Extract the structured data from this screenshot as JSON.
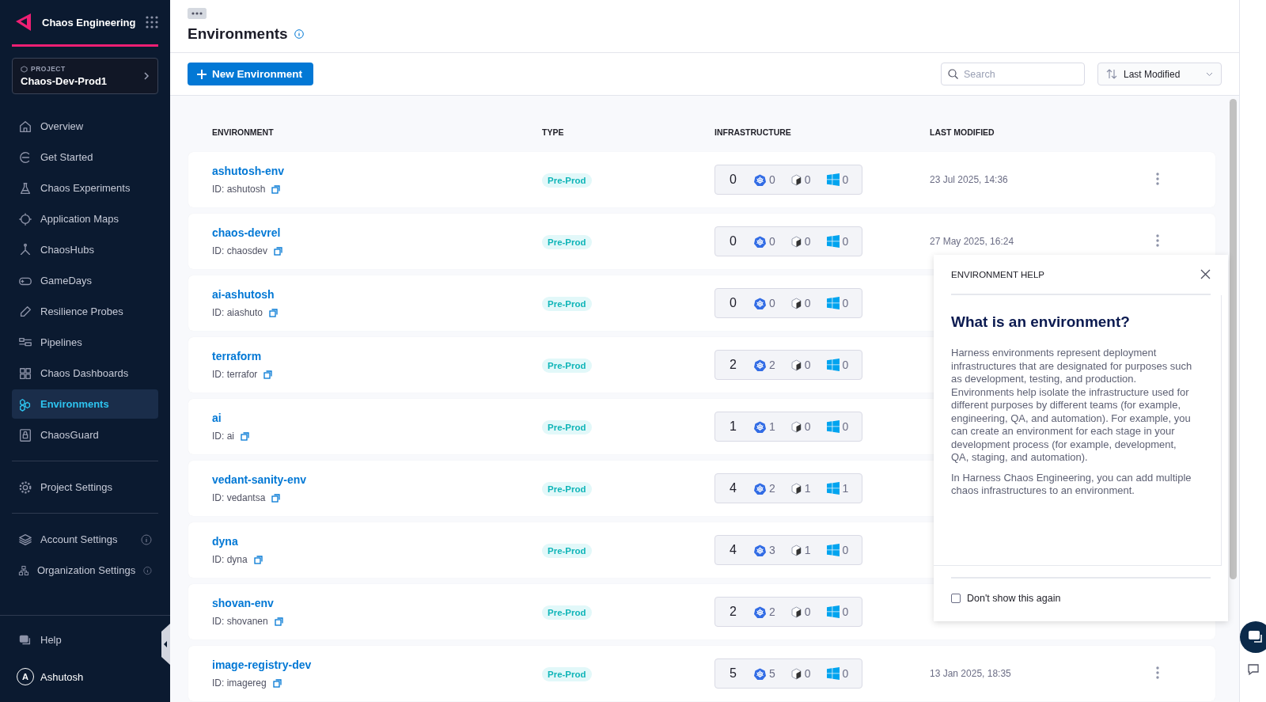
{
  "sidebar": {
    "module_title": "Chaos Engineering",
    "project": {
      "label": "PROJECT",
      "name": "Chaos-Dev-Prod1"
    },
    "nav": [
      {
        "label": "Overview",
        "selected": false
      },
      {
        "label": "Get Started",
        "selected": false
      },
      {
        "label": "Chaos Experiments",
        "selected": false
      },
      {
        "label": "Application Maps",
        "selected": false
      },
      {
        "label": "ChaosHubs",
        "selected": false
      },
      {
        "label": "GameDays",
        "selected": false
      },
      {
        "label": "Resilience Probes",
        "selected": false
      },
      {
        "label": "Pipelines",
        "selected": false
      },
      {
        "label": "Chaos Dashboards",
        "selected": false
      },
      {
        "label": "Environments",
        "selected": true
      },
      {
        "label": "ChaosGuard",
        "selected": false
      }
    ],
    "project_settings": {
      "label": "Project Settings"
    },
    "admin": [
      {
        "label": "Account Settings"
      },
      {
        "label": "Organization Settings"
      }
    ],
    "help": "Help",
    "user": {
      "initial": "A",
      "name": "Ashutosh"
    }
  },
  "header": {
    "title": "Environments"
  },
  "toolbar": {
    "new_button": "New Environment",
    "search": {
      "placeholder": "Search"
    },
    "sort": "Last Modified"
  },
  "table": {
    "columns": [
      "ENVIRONMENT",
      "TYPE",
      "INFRASTRUCTURE",
      "LAST MODIFIED"
    ],
    "rows": [
      {
        "name": "ashutosh-env",
        "id": "ID: ashutosh",
        "type": "Pre-Prod",
        "infra": {
          "total": "0",
          "kubernetes": "0",
          "linux": "0",
          "windows": "0"
        },
        "last_modified": "23 Jul 2025, 14:36"
      },
      {
        "name": "chaos-devrel",
        "id": "ID: chaosdev",
        "type": "Pre-Prod",
        "infra": {
          "total": "0",
          "kubernetes": "0",
          "linux": "0",
          "windows": "0"
        },
        "last_modified": "27 May 2025, 16:24"
      },
      {
        "name": "ai-ashutosh",
        "id": "ID: aiashuto",
        "type": "Pre-Prod",
        "infra": {
          "total": "0",
          "kubernetes": "0",
          "linux": "0",
          "windows": "0"
        }
      },
      {
        "name": "terraform",
        "id": "ID: terrafor",
        "type": "Pre-Prod",
        "infra": {
          "total": "2",
          "kubernetes": "2",
          "linux": "0",
          "windows": "0"
        }
      },
      {
        "name": "ai",
        "id": "ID: ai",
        "type": "Pre-Prod",
        "infra": {
          "total": "1",
          "kubernetes": "1",
          "linux": "0",
          "windows": "0"
        }
      },
      {
        "name": "vedant-sanity-env",
        "id": "ID: vedantsa",
        "type": "Pre-Prod",
        "infra": {
          "total": "4",
          "kubernetes": "2",
          "linux": "1",
          "windows": "1"
        }
      },
      {
        "name": "dyna",
        "id": "ID: dyna",
        "type": "Pre-Prod",
        "infra": {
          "total": "4",
          "kubernetes": "3",
          "linux": "1",
          "windows": "0"
        }
      },
      {
        "name": "shovan-env",
        "id": "ID: shovanen",
        "type": "Pre-Prod",
        "infra": {
          "total": "2",
          "kubernetes": "2",
          "linux": "0",
          "windows": "0"
        }
      },
      {
        "name": "image-registry-dev",
        "id": "ID: imagereg",
        "type": "Pre-Prod",
        "infra": {
          "total": "5",
          "kubernetes": "5",
          "linux": "0",
          "windows": "0"
        },
        "last_modified": "13 Jan 2025, 18:35"
      }
    ]
  },
  "help_panel": {
    "title": "ENVIRONMENT HELP",
    "heading": "What is an environment?",
    "paragraphs": [
      "Harness environments represent deployment infrastructures that are designated for purposes such as development, testing, and production. Environments help isolate the infrastructure used for different purposes by different teams (for example, engineering, QA, and automation). For example, you can create an environment for each stage in your development process (for example, development, QA, staging, and automation).",
      "In Harness Chaos Engineering, you can add multiple chaos infrastructures to an environment."
    ],
    "checkbox": {
      "label": "Don't show this again",
      "checked": false
    }
  }
}
